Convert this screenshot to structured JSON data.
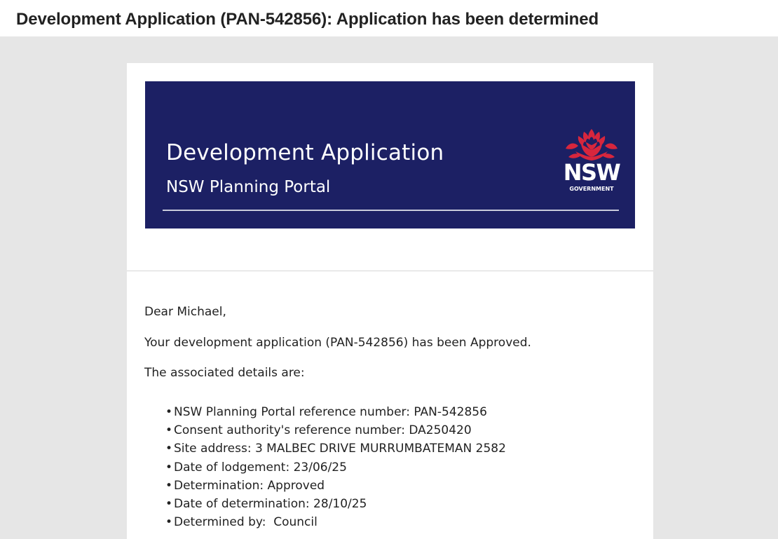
{
  "email": {
    "subject": "Development Application (PAN-542856): Application has been determined"
  },
  "banner": {
    "title": "Development Application",
    "subtitle": "NSW Planning Portal",
    "logo_text": "NSW",
    "logo_subtext": "GOVERNMENT",
    "background_color": "#1c2064",
    "logo_icon": "waratah-flower-icon",
    "logo_flower_color": "#d7263d"
  },
  "message": {
    "greeting": "Dear Michael,",
    "status_line": "Your development application (PAN-542856) has been Approved.",
    "details_intro": "The associated details are:",
    "bullet_glyph": "•",
    "details": [
      "NSW Planning Portal reference number: PAN-542856",
      "Consent authority's reference number: DA250420",
      "Site address: 3 MALBEC DRIVE MURRUMBATEMAN 2582",
      "Date of lodgement: 23/06/25",
      "Determination: Approved",
      "Date of determination: 28/10/25",
      "Determined by:  Council"
    ]
  }
}
